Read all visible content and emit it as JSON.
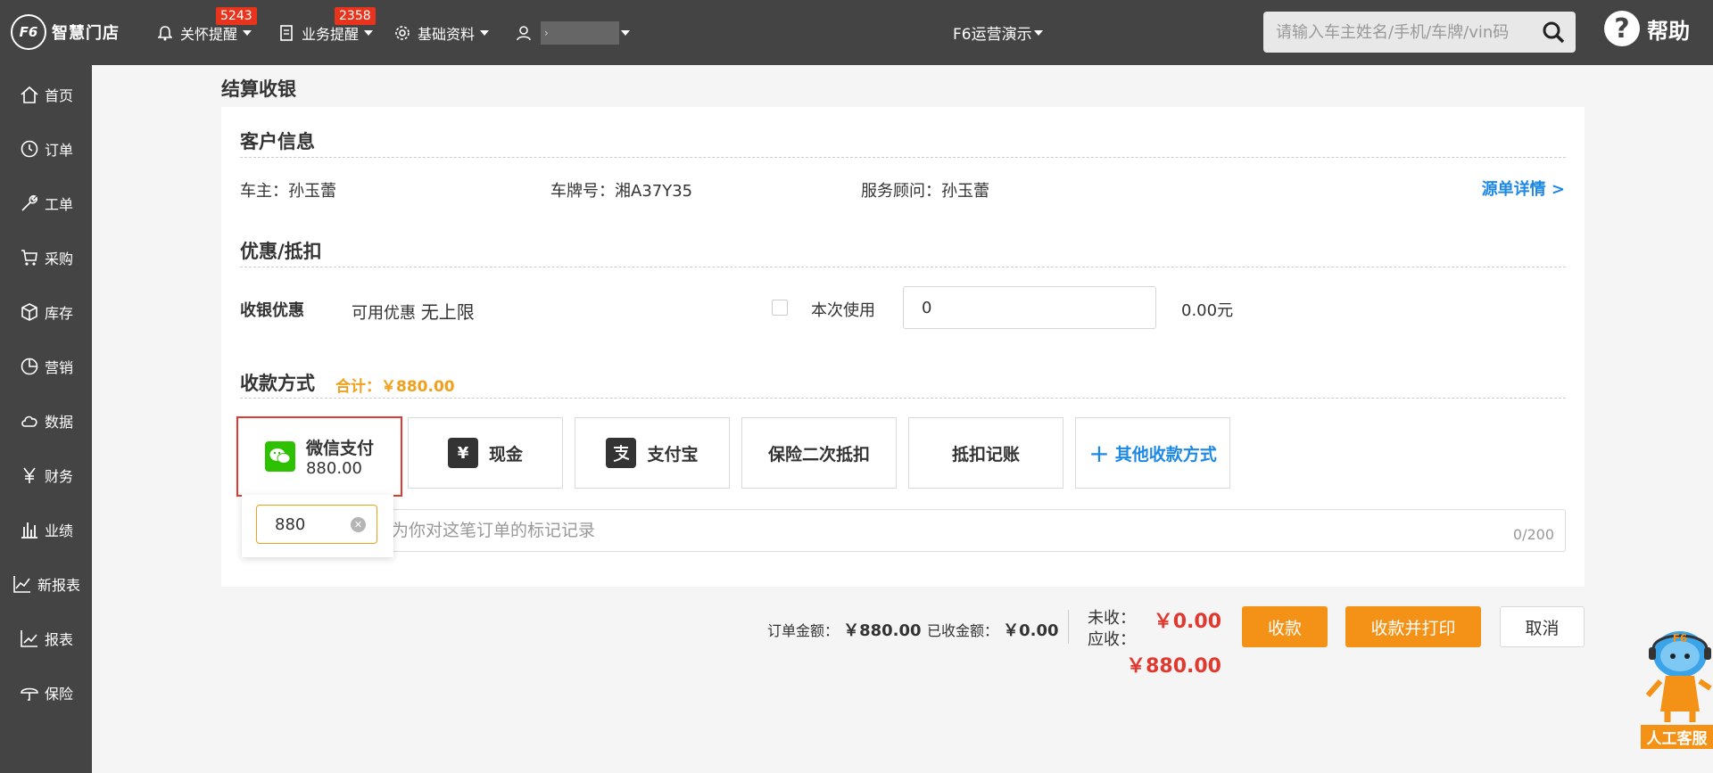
{
  "topbar": {
    "logo_mark": "F6",
    "logo_text": "智慧门店",
    "nav": [
      {
        "label": "关怀提醒",
        "badge": "5243",
        "icon": "bell-icon"
      },
      {
        "label": "业务提醒",
        "badge": "2358",
        "icon": "document-icon"
      },
      {
        "label": "基础资料",
        "badge": "",
        "icon": "gear-icon"
      }
    ],
    "user_name": "›",
    "store_name": "F6运营演示",
    "search_placeholder": "请输入车主姓名/手机/车牌/vin码",
    "help_label": "帮助",
    "help_glyph": "?"
  },
  "sidebar": {
    "items": [
      {
        "label": "首页",
        "icon": "home-icon"
      },
      {
        "label": "订单",
        "icon": "clock-icon"
      },
      {
        "label": "工单",
        "icon": "wrench-icon"
      },
      {
        "label": "采购",
        "icon": "cart-icon"
      },
      {
        "label": "库存",
        "icon": "box-icon"
      },
      {
        "label": "营销",
        "icon": "pie-icon"
      },
      {
        "label": "数据",
        "icon": "cloud-icon"
      },
      {
        "label": "财务",
        "icon": "yen-icon"
      },
      {
        "label": "业绩",
        "icon": "bar-chart-icon"
      },
      {
        "label": "新报表",
        "icon": "line-chart-icon"
      },
      {
        "label": "报表",
        "icon": "trend-icon"
      },
      {
        "label": "保险",
        "icon": "umbrella-icon"
      }
    ]
  },
  "page": {
    "title": "结算收银",
    "customer": {
      "section_title": "客户信息",
      "owner": "车主：孙玉蕾",
      "plate": "车牌号：湘A37Y35",
      "advisor": "服务顾问：孙玉蕾",
      "detail_link": "源单详情 >"
    },
    "discount": {
      "section_title": "优惠/抵扣",
      "label": "收银优惠",
      "available_prefix": "可用优惠",
      "available_value": "无上限",
      "use_label": "本次使用",
      "use_value": "0",
      "amount": "0.00元"
    },
    "payment": {
      "section_title": "收款方式",
      "total": "合计：￥880.00",
      "methods": [
        {
          "label": "微信支付",
          "sub": "880.00",
          "icon": "wechat-icon",
          "selected": true
        },
        {
          "label": "现金",
          "icon": "yen-icon"
        },
        {
          "label": "支付宝",
          "icon": "alipay-icon"
        },
        {
          "label": "保险二次抵扣"
        },
        {
          "label": "抵扣记账"
        },
        {
          "label": "其他收款方式",
          "prefix": "+"
        }
      ],
      "popup_value": "880",
      "remark_placeholder": "为你对这笔订单的标记记录",
      "remark_counter": "0/200"
    }
  },
  "footer": {
    "order_amount_label": "订单金额：",
    "order_amount": "￥880.00",
    "received_label": "已收金额：",
    "received": "￥0.00",
    "unpaid_label": "未收：",
    "unpaid": "￥0.00",
    "due_label": "应收：",
    "due": "￥880.00",
    "btn_collect": "收款",
    "btn_collect_print": "收款并打印",
    "btn_cancel": "取消"
  },
  "service": {
    "label": "人工客服",
    "badge": "F6"
  },
  "colors": {
    "topbar": "#444444",
    "accent_orange": "#f39216",
    "link_blue": "#1e88e5",
    "alert_red": "#e03a30",
    "wechat_green": "#2dc100"
  }
}
